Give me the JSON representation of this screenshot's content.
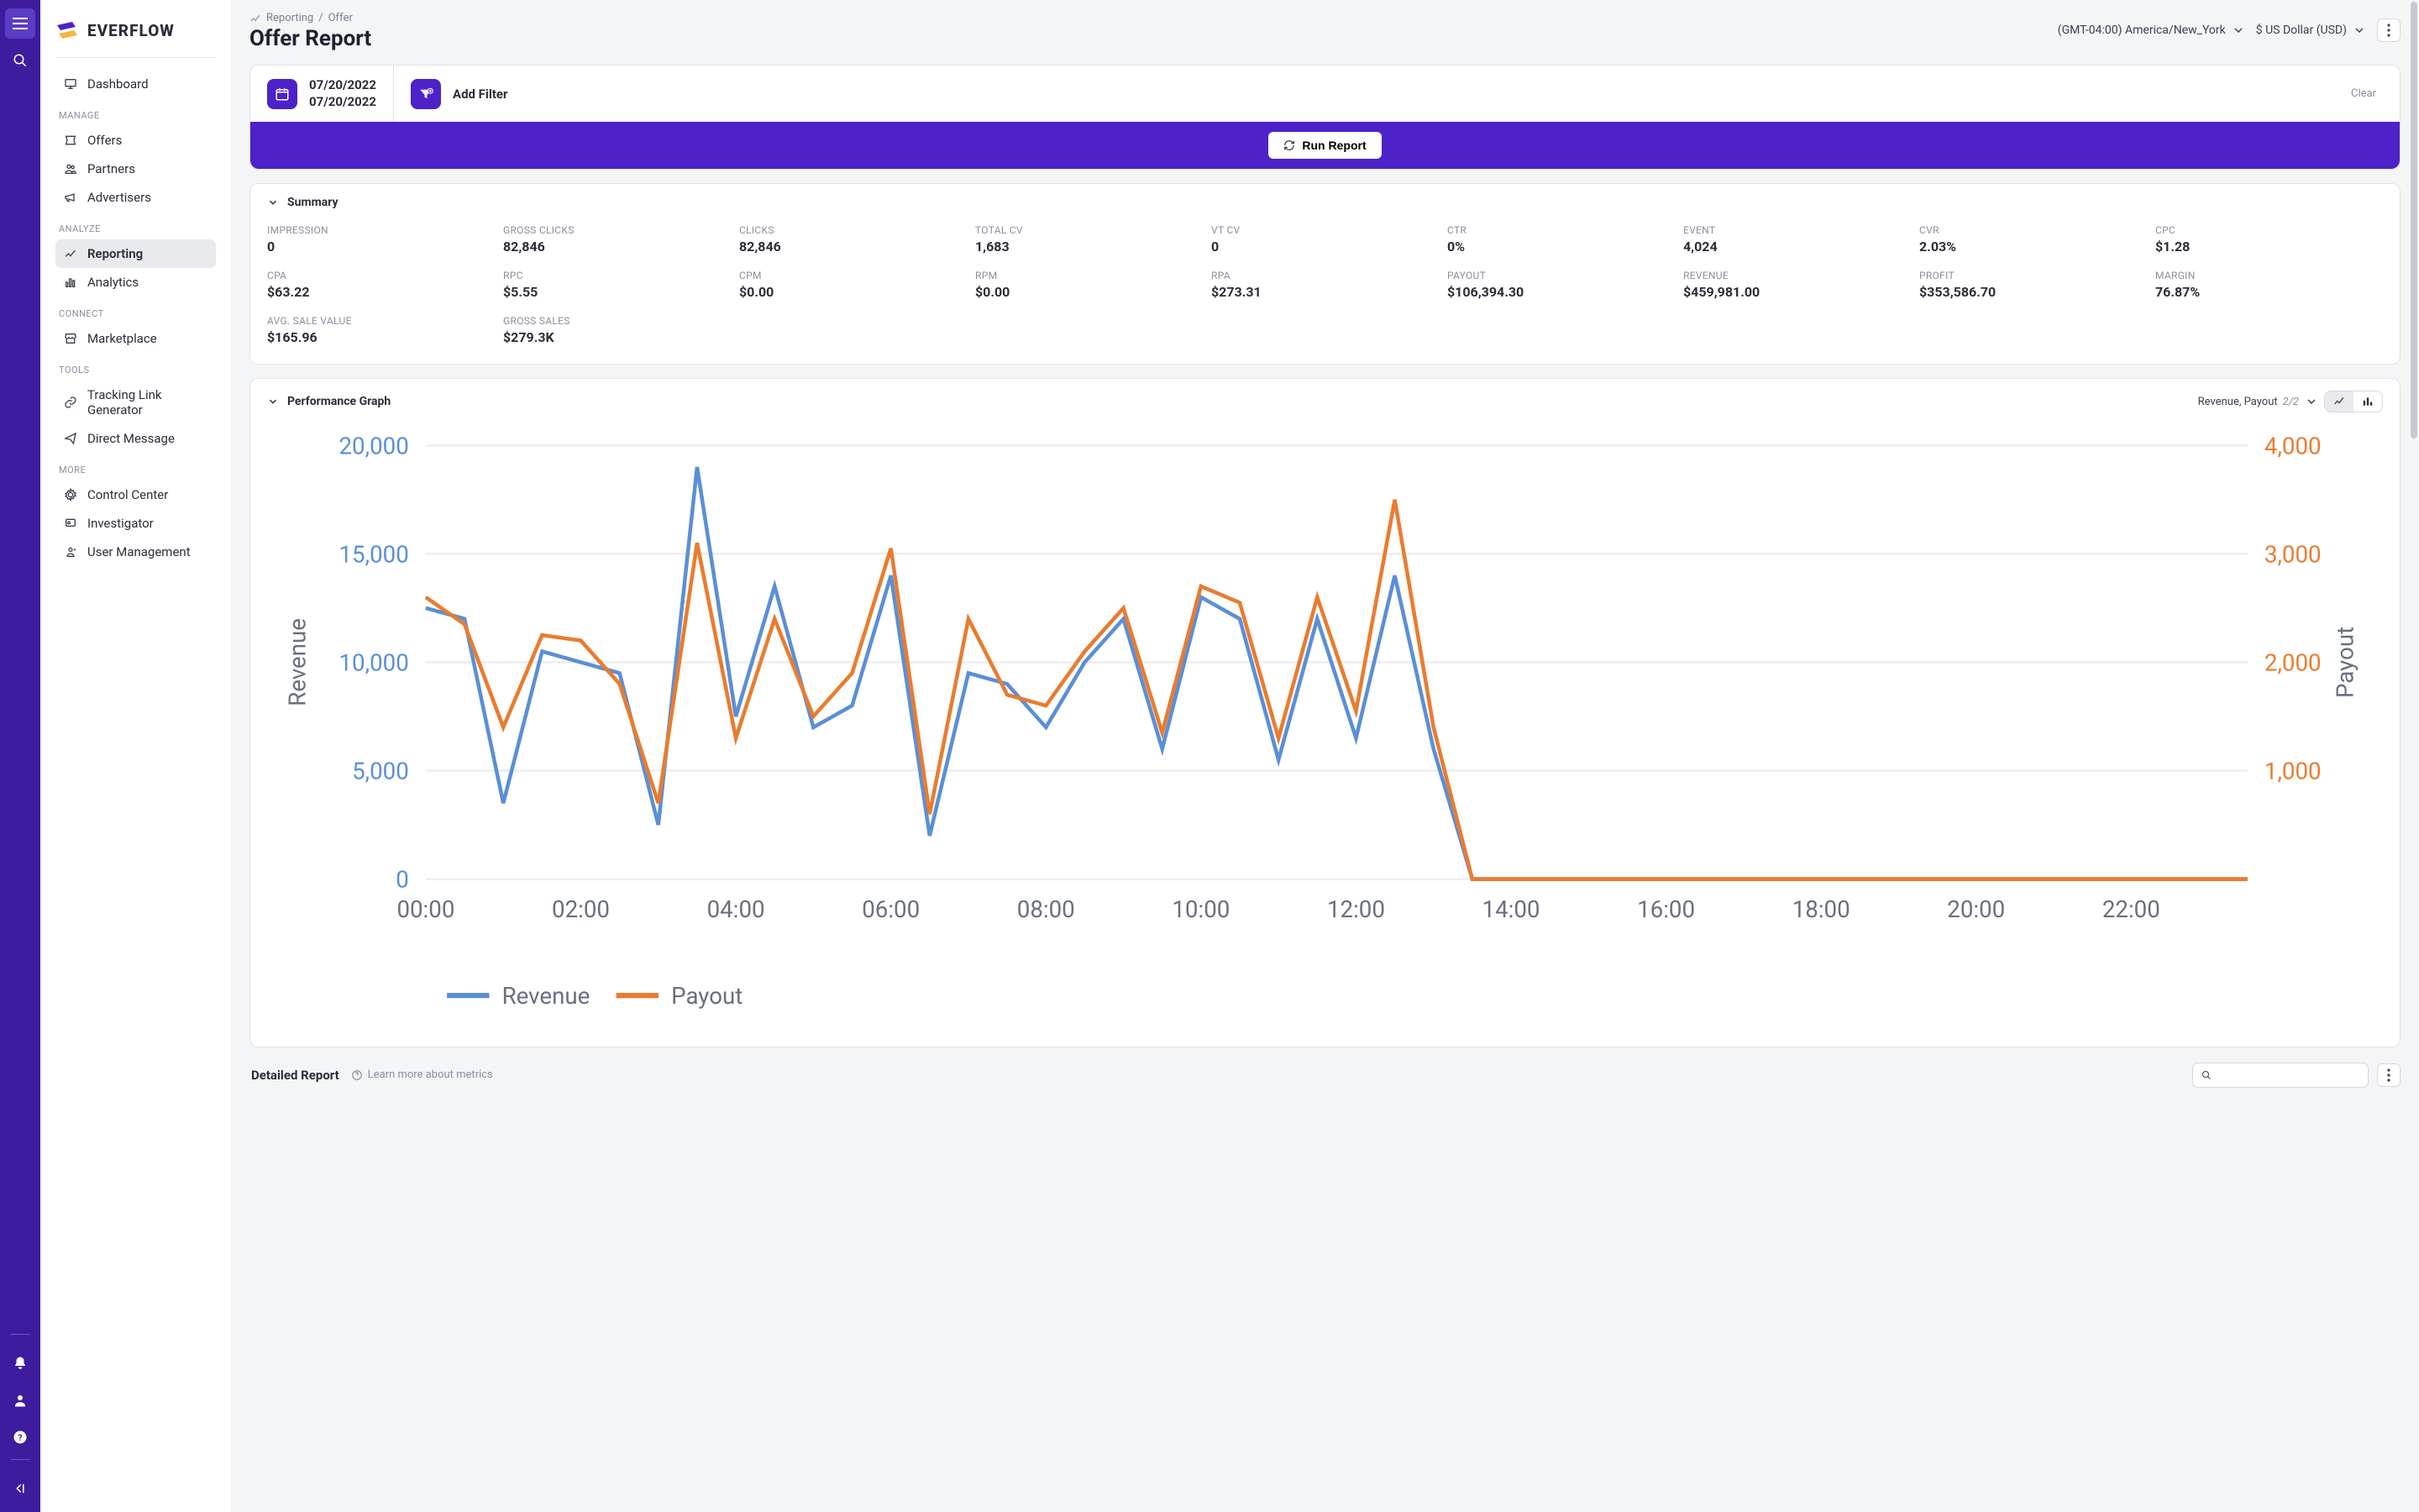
{
  "brand": "EVERFLOW",
  "rail": {
    "icons": [
      "menu",
      "search",
      "bell",
      "user",
      "help",
      "collapse"
    ]
  },
  "sidebar": {
    "items": [
      {
        "icon": "monitor",
        "label": "Dashboard"
      }
    ],
    "sections": [
      {
        "title": "MANAGE",
        "items": [
          {
            "icon": "ticket",
            "label": "Offers"
          },
          {
            "icon": "people",
            "label": "Partners"
          },
          {
            "icon": "megaphone",
            "label": "Advertisers"
          }
        ]
      },
      {
        "title": "ANALYZE",
        "items": [
          {
            "icon": "chart",
            "label": "Reporting",
            "active": true
          },
          {
            "icon": "analytics",
            "label": "Analytics"
          }
        ]
      },
      {
        "title": "CONNECT",
        "items": [
          {
            "icon": "store",
            "label": "Marketplace"
          }
        ]
      },
      {
        "title": "TOOLS",
        "items": [
          {
            "icon": "link",
            "label": "Tracking Link Generator"
          },
          {
            "icon": "send",
            "label": "Direct Message"
          }
        ]
      },
      {
        "title": "MORE",
        "items": [
          {
            "icon": "gear",
            "label": "Control Center"
          },
          {
            "icon": "badge",
            "label": "Investigator"
          },
          {
            "icon": "users",
            "label": "User Management"
          }
        ]
      }
    ]
  },
  "breadcrumb": {
    "icon": "chart",
    "parent": "Reporting",
    "sep": "/",
    "current": "Offer"
  },
  "page_title": "Offer Report",
  "top_right": {
    "timezone": "(GMT-04:00) America/New_York",
    "currency": "$ US Dollar (USD)"
  },
  "filter": {
    "start": "07/20/2022",
    "end": "07/20/2022",
    "add_label": "Add Filter",
    "clear_label": "Clear",
    "run_label": "Run Report"
  },
  "summary": {
    "title": "Summary",
    "metrics": [
      {
        "label": "IMPRESSION",
        "value": "0"
      },
      {
        "label": "GROSS CLICKS",
        "value": "82,846"
      },
      {
        "label": "CLICKS",
        "value": "82,846"
      },
      {
        "label": "TOTAL CV",
        "value": "1,683"
      },
      {
        "label": "VT CV",
        "value": "0"
      },
      {
        "label": "CTR",
        "value": "0%"
      },
      {
        "label": "EVENT",
        "value": "4,024"
      },
      {
        "label": "CVR",
        "value": "2.03%"
      },
      {
        "label": "CPC",
        "value": "$1.28"
      },
      {
        "label": "CPA",
        "value": "$63.22"
      },
      {
        "label": "RPC",
        "value": "$5.55"
      },
      {
        "label": "CPM",
        "value": "$0.00"
      },
      {
        "label": "RPM",
        "value": "$0.00"
      },
      {
        "label": "RPA",
        "value": "$273.31"
      },
      {
        "label": "PAYOUT",
        "value": "$106,394.30"
      },
      {
        "label": "REVENUE",
        "value": "$459,981.00"
      },
      {
        "label": "PROFIT",
        "value": "$353,586.70"
      },
      {
        "label": "MARGIN",
        "value": "76.87%"
      },
      {
        "label": "AVG. SALE VALUE",
        "value": "$165.96"
      },
      {
        "label": "GROSS SALES",
        "value": "$279.3K"
      }
    ]
  },
  "perf": {
    "title": "Performance Graph",
    "selector_label": "Revenue, Payout",
    "selector_count": "2/2",
    "legend": {
      "revenue": "Revenue",
      "payout": "Payout"
    },
    "axis_left": "Revenue",
    "axis_right": "Payout"
  },
  "detailed": {
    "title": "Detailed Report",
    "learn": "Learn more about metrics"
  },
  "colors": {
    "purple": "#4d22c9",
    "rail": "#3d1d9e",
    "blue": "#5b8fd6",
    "orange": "#e97c2f"
  },
  "chart_data": {
    "type": "line",
    "x": [
      "00:00",
      "00:30",
      "01:00",
      "01:30",
      "02:00",
      "02:30",
      "03:00",
      "03:30",
      "04:00",
      "04:30",
      "05:00",
      "05:30",
      "06:00",
      "06:30",
      "07:00",
      "07:30",
      "08:00",
      "08:30",
      "09:00",
      "09:30",
      "10:00",
      "10:30",
      "11:00",
      "11:30",
      "12:00",
      "12:30",
      "13:00",
      "13:30",
      "14:00",
      "14:30",
      "15:00",
      "15:30",
      "16:00",
      "16:30",
      "17:00",
      "17:30",
      "18:00",
      "18:30",
      "19:00",
      "19:30",
      "20:00",
      "20:30",
      "21:00",
      "21:30",
      "22:00",
      "22:30",
      "23:00",
      "23:30"
    ],
    "x_ticks": [
      "00:00",
      "02:00",
      "04:00",
      "06:00",
      "08:00",
      "10:00",
      "12:00",
      "14:00",
      "16:00",
      "18:00",
      "20:00",
      "22:00"
    ],
    "series": [
      {
        "name": "Revenue",
        "axis": "left",
        "color": "#5b8fd6",
        "values": [
          12500,
          12000,
          3500,
          10500,
          10000,
          9500,
          2500,
          19000,
          7500,
          13500,
          7000,
          8000,
          14000,
          2000,
          9500,
          9000,
          7000,
          10000,
          12000,
          6000,
          13000,
          12000,
          5500,
          12000,
          6500,
          14000,
          6000,
          0,
          0,
          0,
          0,
          0,
          0,
          0,
          0,
          0,
          0,
          0,
          0,
          0,
          0,
          0,
          0,
          0,
          0,
          0,
          0,
          0
        ]
      },
      {
        "name": "Payout",
        "axis": "right",
        "color": "#e97c2f",
        "values": [
          2600,
          2350,
          1400,
          2250,
          2200,
          1800,
          700,
          3100,
          1300,
          2400,
          1500,
          1900,
          3050,
          600,
          2400,
          1700,
          1600,
          2100,
          2500,
          1350,
          2700,
          2550,
          1300,
          2600,
          1550,
          3500,
          1400,
          0,
          0,
          0,
          0,
          0,
          0,
          0,
          0,
          0,
          0,
          0,
          0,
          0,
          0,
          0,
          0,
          0,
          0,
          0,
          0,
          0
        ]
      }
    ],
    "y_left": {
      "label": "Revenue",
      "ticks": [
        0,
        5000,
        10000,
        15000,
        20000
      ],
      "lim": [
        0,
        20000
      ]
    },
    "y_right": {
      "label": "Payout",
      "ticks": [
        1000,
        2000,
        3000,
        4000
      ],
      "lim": [
        0,
        4000
      ]
    }
  }
}
